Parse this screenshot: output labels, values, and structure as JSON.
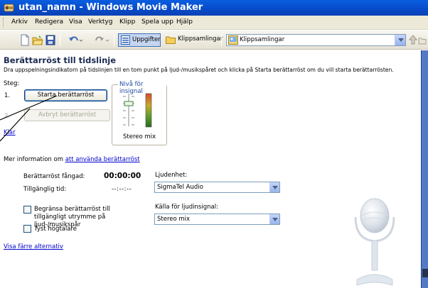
{
  "window": {
    "title": "utan_namn - Windows Movie Maker"
  },
  "menu": [
    "Arkiv",
    "Redigera",
    "Visa",
    "Verktyg",
    "Klipp",
    "Spela upp",
    "Hjälp"
  ],
  "toolbar": {
    "tasks_label": "Uppgifter",
    "collections_label": "Klippsamlingar",
    "collection_select_value": "Klippsamlingar"
  },
  "narration": {
    "heading": "Berättarröst till tidslinje",
    "instructions": "Dra uppspelningsindikatorn på tidslinjen till en tom punkt på ljud-/musikspåret och klicka på Starta berättarröst om du vill starta berättarrösten.",
    "steps_label": "Steg:",
    "step1_number": "1.",
    "step2_number": "2.",
    "start_button": "Starta berättarröst",
    "stop_button": "Avbryt berättarröst",
    "done_link": "Klar",
    "input_level": {
      "label": "Nivå för insignal",
      "source": "Stereo mix"
    },
    "more_info_prefix": "Mer information om",
    "more_info_link": "att använda berättarröst",
    "captured_label": "Berättarröst fångad:",
    "captured_value": "00:00:00",
    "available_label": "Tillgänglig tid:",
    "available_value": "--:--:--",
    "audio_device_label": "Ljudenhet:",
    "audio_device_value": "SigmaTel Audio",
    "input_source_label": "Källa för ljudinsignal:",
    "input_source_value": "Stereo mix",
    "limit_checkbox_label": "Begränsa berättarröst till tillgängligt utrymme på ljud-/musikspår",
    "mute_checkbox_label": "Tyst högtalare",
    "fewer_options_link": "Visa färre alternativ"
  }
}
